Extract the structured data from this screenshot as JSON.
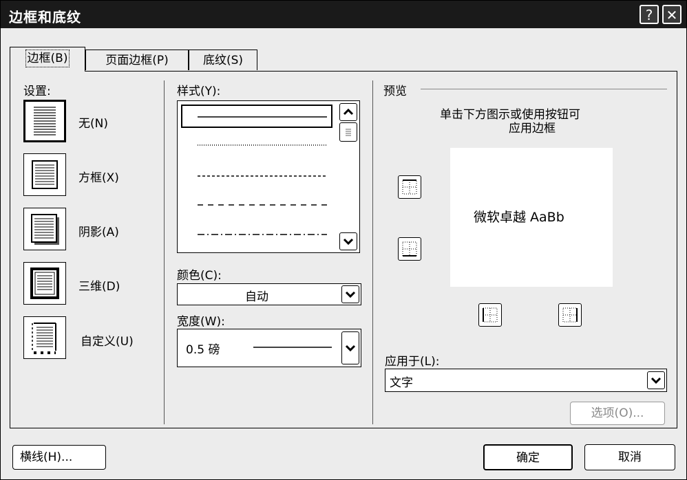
{
  "dialog": {
    "title": "边框和底纹"
  },
  "titlebar": {
    "help_symbol": "?",
    "close_symbol": "✕"
  },
  "tabs": [
    {
      "label": "边框(B)",
      "active": true
    },
    {
      "label": "页面边框(P)",
      "active": false
    },
    {
      "label": "底纹(S)",
      "active": false
    }
  ],
  "settings": {
    "label": "设置:",
    "items": [
      {
        "label": "无(N)",
        "icon": "no-border-icon",
        "selected": true
      },
      {
        "label": "方框(X)",
        "icon": "box-border-icon",
        "selected": false
      },
      {
        "label": "阴影(A)",
        "icon": "shadow-border-icon",
        "selected": false
      },
      {
        "label": "三维(D)",
        "icon": "3d-border-icon",
        "selected": false
      },
      {
        "label": "自定义(U)",
        "icon": "custom-border-icon",
        "selected": false
      }
    ]
  },
  "style": {
    "label": "样式(Y):",
    "options": [
      "solid",
      "dotted",
      "fine-dashed",
      "dashed",
      "dash-dot"
    ],
    "selected_index": 0
  },
  "color": {
    "label": "颜色(C):",
    "value": "自动"
  },
  "width": {
    "label": "宽度(W):",
    "value": "0.5 磅"
  },
  "preview": {
    "label": "预览",
    "hint_line1": "单击下方图示或使用按钮可",
    "hint_line2": "应用边框",
    "sample_text": "微软卓越 AaBb"
  },
  "apply_to": {
    "label": "应用于(L):",
    "value": "文字"
  },
  "buttons": {
    "options": "选项(O)...",
    "horizontal_line": "横线(H)...",
    "ok": "确定",
    "cancel": "取消"
  }
}
